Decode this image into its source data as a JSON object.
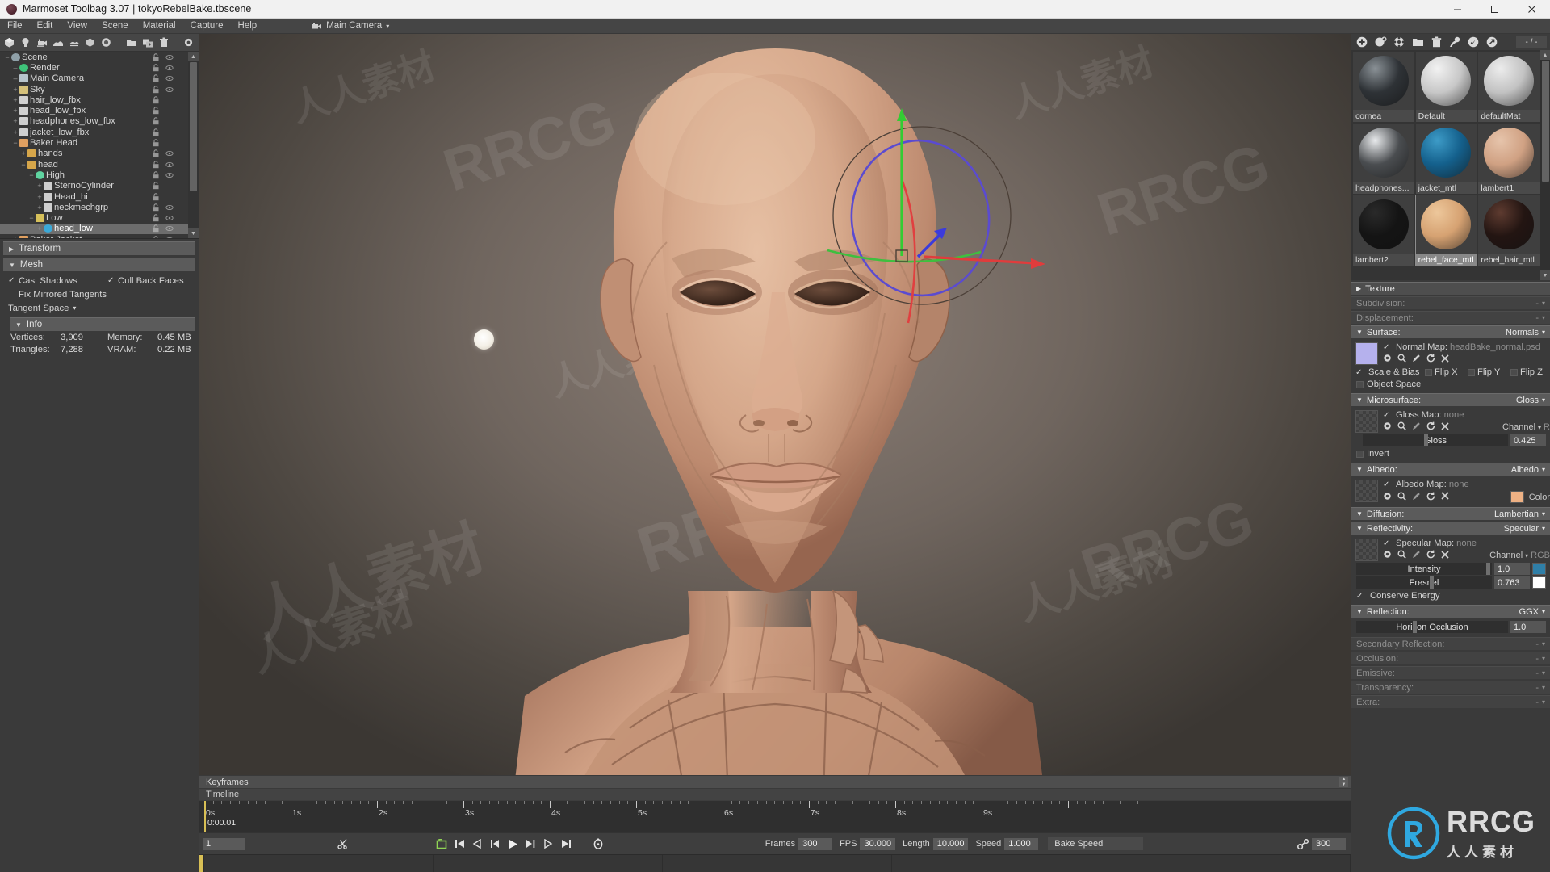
{
  "window": {
    "title": "Marmoset Toolbag 3.07  |  tokyoRebelBake.tbscene",
    "minimize": "–",
    "maximize": "☐",
    "close": "✕"
  },
  "menubar": {
    "items": [
      "File",
      "Edit",
      "View",
      "Scene",
      "Material",
      "Capture",
      "Help"
    ]
  },
  "viewport_bar": {
    "camera_label": "Main Camera",
    "camera_caret": "▾"
  },
  "scene_toolbar": {
    "icons": [
      "mesh-icon",
      "light-icon",
      "camera-icon",
      "sky-icon",
      "fog-icon",
      "object-icon",
      "render-icon",
      "folder-icon",
      "duplicate-icon",
      "trash-icon",
      "settings-icon"
    ]
  },
  "scene_tree": {
    "items": [
      {
        "label": "Scene",
        "depth": 0,
        "expander": "−",
        "icon": "scene-icon",
        "icon_color": "#8fa0a8",
        "lock": true,
        "eye": true,
        "selected": false
      },
      {
        "label": "Render",
        "depth": 1,
        "expander": "–",
        "icon": "render-icon",
        "icon_color": "#3fc37a",
        "lock": true,
        "eye": true,
        "selected": false
      },
      {
        "label": "Main Camera",
        "depth": 1,
        "expander": "–",
        "icon": "camera-icon",
        "icon_color": "#b8c4cc",
        "lock": true,
        "eye": true,
        "selected": false
      },
      {
        "label": "Sky",
        "depth": 1,
        "expander": "+",
        "icon": "sky-icon",
        "icon_color": "#d4c07a",
        "lock": true,
        "eye": true,
        "selected": false
      },
      {
        "label": "hair_low_fbx",
        "depth": 1,
        "expander": "+",
        "icon": "fbx-icon",
        "icon_color": "#cfcfcf",
        "lock": true,
        "eye": false,
        "selected": false
      },
      {
        "label": "head_low_fbx",
        "depth": 1,
        "expander": "+",
        "icon": "fbx-icon",
        "icon_color": "#cfcfcf",
        "lock": true,
        "eye": false,
        "selected": false
      },
      {
        "label": "headphones_low_fbx",
        "depth": 1,
        "expander": "+",
        "icon": "fbx-icon",
        "icon_color": "#cfcfcf",
        "lock": true,
        "eye": false,
        "selected": false
      },
      {
        "label": "jacket_low_fbx",
        "depth": 1,
        "expander": "+",
        "icon": "fbx-icon",
        "icon_color": "#cfcfcf",
        "lock": true,
        "eye": false,
        "selected": false
      },
      {
        "label": "Baker Head",
        "depth": 1,
        "expander": "−",
        "icon": "baker-icon",
        "icon_color": "#e0a060",
        "lock": true,
        "eye": false,
        "selected": false
      },
      {
        "label": "hands",
        "depth": 2,
        "expander": "+",
        "icon": "folder-icon",
        "icon_color": "#d6a64a",
        "lock": true,
        "eye": true,
        "selected": false
      },
      {
        "label": "head",
        "depth": 2,
        "expander": "−",
        "icon": "folder-icon",
        "icon_color": "#d6a64a",
        "lock": true,
        "eye": true,
        "selected": false
      },
      {
        "label": "High",
        "depth": 3,
        "expander": "−",
        "icon": "high-icon",
        "icon_color": "#5fd3a0",
        "lock": true,
        "eye": true,
        "selected": false
      },
      {
        "label": "SternoCylinder",
        "depth": 4,
        "expander": "+",
        "icon": "mesh-icon",
        "icon_color": "#cfcfcf",
        "lock": true,
        "eye": false,
        "selected": false
      },
      {
        "label": "Head_hi",
        "depth": 4,
        "expander": "+",
        "icon": "mesh-icon",
        "icon_color": "#cfcfcf",
        "lock": true,
        "eye": false,
        "selected": false
      },
      {
        "label": "neckmechgrp",
        "depth": 4,
        "expander": "+",
        "icon": "mesh-icon",
        "icon_color": "#cfcfcf",
        "lock": true,
        "eye": true,
        "selected": false
      },
      {
        "label": "Low",
        "depth": 3,
        "expander": "−",
        "icon": "low-icon",
        "icon_color": "#d6c05a",
        "lock": true,
        "eye": true,
        "selected": false
      },
      {
        "label": "head_low",
        "depth": 4,
        "expander": "+",
        "icon": "lowmesh-icon",
        "icon_color": "#3ba9d8",
        "lock": true,
        "eye": true,
        "selected": true
      },
      {
        "label": "Baker Jacket",
        "depth": 1,
        "expander": "+",
        "icon": "baker-icon",
        "icon_color": "#e0a060",
        "lock": true,
        "eye": true,
        "selected": false
      }
    ]
  },
  "object_panel": {
    "transform": {
      "label": "Transform",
      "caret": "▶"
    },
    "mesh": {
      "label": "Mesh",
      "caret": "▼",
      "cast_shadows": {
        "label": "Cast Shadows",
        "checked": true
      },
      "cull_back_faces": {
        "label": "Cull Back Faces",
        "checked": true
      },
      "fix_mirrored_tangents": {
        "label": "Fix Mirrored Tangents",
        "checked": false
      },
      "tangent_space": {
        "label": "Tangent Space",
        "caret": "▾"
      }
    },
    "info": {
      "label": "Info",
      "caret": "▼",
      "rows": [
        {
          "k1": "Vertices:",
          "v1": "3,909",
          "k2": "Memory:",
          "v2": "0.45 MB"
        },
        {
          "k1": "Triangles:",
          "v1": "7,288",
          "k2": "VRAM:",
          "v2": "0.22 MB"
        }
      ]
    }
  },
  "timeline": {
    "keyframes_label": "Keyframes",
    "timeline_label": "Timeline",
    "current_time": "0:00.01",
    "current_frame": "1",
    "ticks": [
      "0s",
      "1s",
      "2s",
      "3s",
      "4s",
      "5s",
      "6s",
      "7s",
      "8s",
      "9s"
    ],
    "transport_icons": [
      "scissors-icon",
      "loop-icon",
      "skip-start-icon",
      "step-back-icon",
      "prev-key-icon",
      "play-icon",
      "next-key-icon",
      "step-forward-icon",
      "skip-end-icon",
      "stopwatch-icon"
    ],
    "fields": [
      {
        "label": "Frames",
        "value": "300"
      },
      {
        "label": "FPS",
        "value": "30.000"
      },
      {
        "label": "Length",
        "value": "10.000"
      },
      {
        "label": "Speed",
        "value": "1.000"
      }
    ],
    "bake_speed_label": "Bake Speed",
    "link_value": "300",
    "link_icon": "link-icon"
  },
  "materials": {
    "toolbar_icons": [
      "add-material-icon",
      "duplicate-material-icon",
      "library-icon",
      "folder-icon",
      "trash-icon",
      "assign-icon",
      "pick-icon",
      "export-icon"
    ],
    "counter": "- / -",
    "grid": [
      {
        "name": "cornea",
        "color": "#2e3236",
        "hl": "#8a9196",
        "selected": false
      },
      {
        "name": "Default",
        "color": "#c7c7c7",
        "hl": "#f2f2f2",
        "selected": false
      },
      {
        "name": "defaultMat",
        "color": "#c2c2c2",
        "hl": "#ececec",
        "selected": false
      },
      {
        "name": "headphones...",
        "color": "#4a4d50",
        "hl": "#e8eaec",
        "selected": false
      },
      {
        "name": "jacket_mtl",
        "color": "#14608c",
        "hl": "#3d9bc7",
        "selected": false
      },
      {
        "name": "lambert1",
        "color": "#d0a183",
        "hl": "#e6c4ab",
        "selected": false
      },
      {
        "name": "lambert2",
        "color": "#141414",
        "hl": "#2a2a2a",
        "selected": false
      },
      {
        "name": "rebel_face_mtl",
        "color": "#d6a272",
        "hl": "#edc79b",
        "selected": true
      },
      {
        "name": "rebel_hair_mtl",
        "color": "#231512",
        "hl": "#5e3b30",
        "selected": false
      }
    ]
  },
  "material_props": {
    "texture": {
      "label": "Texture",
      "caret": "▶"
    },
    "subdivision": {
      "label": "Subdivision:",
      "value": "-",
      "caret": "▾",
      "dim": true
    },
    "displacement": {
      "label": "Displacement:",
      "value": "-",
      "caret": "▾",
      "dim": true
    },
    "surface": {
      "label": "Surface:",
      "value": "Normals",
      "caret": "▼",
      "map_label": "Normal Map:",
      "map_value": "headBake_normal.psd",
      "map_checked": true,
      "swatch_color": "#b5b1ed",
      "icons": [
        "gear-icon",
        "search-icon",
        "edit-icon",
        "reload-icon",
        "clear-icon"
      ],
      "flags": [
        {
          "label": "Scale & Bias",
          "checked": true
        },
        {
          "label": "Flip X",
          "checked": false
        },
        {
          "label": "Flip Y",
          "checked": false
        },
        {
          "label": "Flip Z",
          "checked": false
        }
      ],
      "object_space": {
        "label": "Object Space",
        "checked": false
      }
    },
    "microsurface": {
      "label": "Microsurface:",
      "value": "Gloss",
      "caret": "▼",
      "map_label": "Gloss Map:",
      "map_value": "none",
      "map_checked": true,
      "channel_label": "Channel",
      "channel_value": "R",
      "channel_caret": "▾",
      "slider_label": "Gloss",
      "slider_value": "0.425",
      "slider_pct": 42,
      "invert": {
        "label": "Invert",
        "checked": false
      }
    },
    "albedo": {
      "label": "Albedo:",
      "value": "Albedo",
      "caret": "▼",
      "map_label": "Albedo Map:",
      "map_value": "none",
      "map_checked": true,
      "color_label": "Color",
      "color_value": "#eeb184"
    },
    "diffusion": {
      "label": "Diffusion:",
      "value": "Lambertian",
      "caret": "▼"
    },
    "reflectivity": {
      "label": "Reflectivity:",
      "value": "Specular",
      "caret": "▼",
      "map_label": "Specular Map:",
      "map_value": "none",
      "map_checked": true,
      "channel_label": "Channel",
      "channel_value": "RGB",
      "channel_caret": "▾",
      "intensity": {
        "label": "Intensity",
        "value": "1.0",
        "pct": 97,
        "swatch": "#2f7fa8"
      },
      "fresnel": {
        "label": "Fresnel",
        "value": "0.763",
        "pct": 55,
        "swatch": "#ffffff"
      },
      "conserve_energy": {
        "label": "Conserve Energy",
        "checked": true
      }
    },
    "reflection": {
      "label": "Reflection:",
      "value": "GGX",
      "caret": "▼",
      "horizon": {
        "label": "Horizon Occlusion",
        "value": "1.0",
        "pct": 37
      }
    },
    "secondary_reflection": {
      "label": "Secondary Reflection:",
      "value": "-",
      "caret": "▾",
      "dim": true
    },
    "occlusion": {
      "label": "Occlusion:",
      "value": "-",
      "caret": "▾",
      "dim": true
    },
    "emissive": {
      "label": "Emissive:",
      "value": "-",
      "caret": "▾",
      "dim": true
    },
    "transparency": {
      "label": "Transparency:",
      "value": "-",
      "caret": "▾",
      "dim": true
    },
    "extra": {
      "label": "Extra:",
      "value": "-",
      "caret": "▾",
      "dim": true
    }
  },
  "watermarks": {
    "brand": "RRCG",
    "cn": "人人素材"
  }
}
